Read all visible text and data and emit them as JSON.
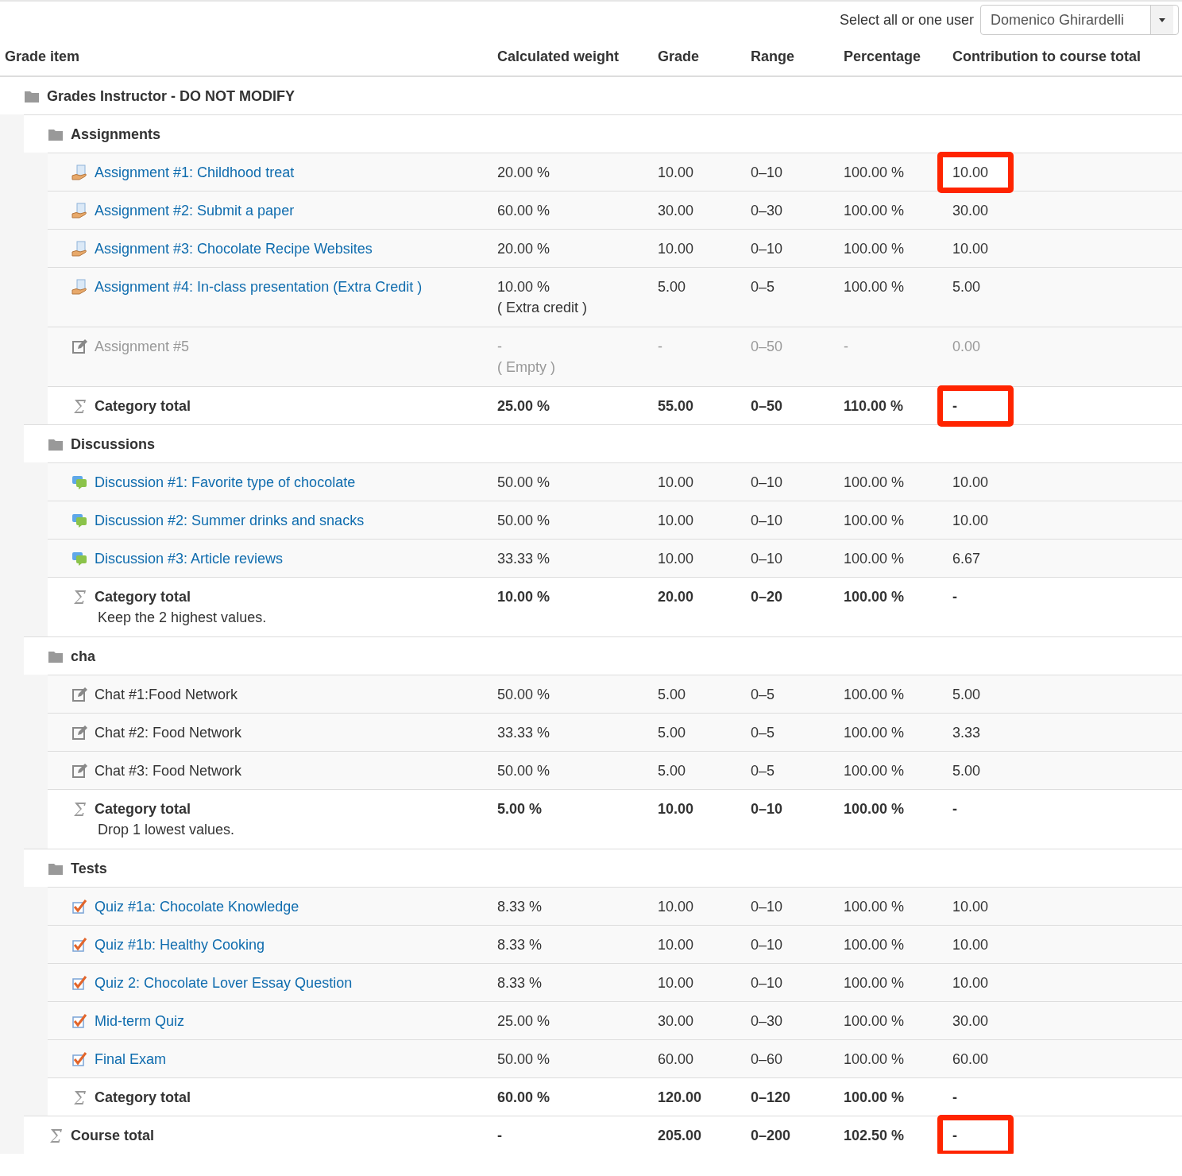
{
  "user_select": {
    "label": "Select all or one user",
    "value": "Domenico Ghirardelli"
  },
  "columns": [
    "Grade item",
    "Calculated weight",
    "Grade",
    "Range",
    "Percentage",
    "Contribution to course total"
  ],
  "report": {
    "kind": "category",
    "name": "Grades Instructor - DO NOT MODIFY",
    "children": [
      {
        "kind": "category",
        "name": "Assignments",
        "children": [
          {
            "kind": "assignment",
            "link": true,
            "dimmed": false,
            "name": "Assignment #1: Childhood treat",
            "weight": "20.00 %",
            "grade": "10.00",
            "range": "0–10",
            "percentage": "100.00 %",
            "contribution": "10.00",
            "highlighted": true
          },
          {
            "kind": "assignment",
            "link": true,
            "dimmed": false,
            "name": "Assignment #2: Submit a paper",
            "weight": "60.00 %",
            "grade": "30.00",
            "range": "0–30",
            "percentage": "100.00 %",
            "contribution": "30.00",
            "highlighted": false
          },
          {
            "kind": "assignment",
            "link": true,
            "dimmed": false,
            "name": "Assignment #3: Chocolate Recipe Websites",
            "weight": "20.00 %",
            "grade": "10.00",
            "range": "0–10",
            "percentage": "100.00 %",
            "contribution": "10.00",
            "highlighted": false
          },
          {
            "kind": "assignment",
            "link": true,
            "dimmed": false,
            "name": "Assignment #4: In-class presentation (Extra Credit )",
            "weight": "10.00 %",
            "weight_note": "( Extra credit )",
            "grade": "5.00",
            "range": "0–5",
            "percentage": "100.00 %",
            "contribution": "5.00",
            "highlighted": false
          },
          {
            "kind": "manual",
            "link": false,
            "dimmed": true,
            "name": "Assignment #5",
            "weight": "-",
            "weight_note": "( Empty )",
            "grade": "-",
            "range": "0–50",
            "percentage": "-",
            "contribution": "0.00",
            "highlighted": false
          },
          {
            "kind": "total",
            "name": "Category total",
            "weight": "25.00 %",
            "grade": "55.00",
            "range": "0–50",
            "percentage": "110.00 %",
            "contribution": "-",
            "highlighted": true
          }
        ]
      },
      {
        "kind": "category",
        "name": "Discussions",
        "children": [
          {
            "kind": "forum",
            "link": true,
            "dimmed": false,
            "name": "Discussion #1: Favorite type of chocolate",
            "weight": "50.00 %",
            "grade": "10.00",
            "range": "0–10",
            "percentage": "100.00 %",
            "contribution": "10.00",
            "highlighted": false
          },
          {
            "kind": "forum",
            "link": true,
            "dimmed": false,
            "name": "Discussion #2: Summer drinks and snacks",
            "weight": "50.00 %",
            "grade": "10.00",
            "range": "0–10",
            "percentage": "100.00 %",
            "contribution": "10.00",
            "highlighted": false
          },
          {
            "kind": "forum",
            "link": true,
            "dimmed": false,
            "name": "Discussion #3: Article reviews",
            "weight": "33.33 %",
            "grade": "10.00",
            "range": "0–10",
            "percentage": "100.00 %",
            "contribution": "6.67",
            "highlighted": false
          },
          {
            "kind": "total",
            "name": "Category total",
            "note": "Keep the 2 highest values.",
            "weight": "10.00 %",
            "grade": "20.00",
            "range": "0–20",
            "percentage": "100.00 %",
            "contribution": "-",
            "highlighted": false
          }
        ]
      },
      {
        "kind": "category",
        "name": "cha",
        "children": [
          {
            "kind": "manual",
            "link": false,
            "dimmed": false,
            "name": "Chat #1:Food Network",
            "weight": "50.00 %",
            "grade": "5.00",
            "range": "0–5",
            "percentage": "100.00 %",
            "contribution": "5.00",
            "highlighted": false
          },
          {
            "kind": "manual",
            "link": false,
            "dimmed": false,
            "name": "Chat #2: Food Network",
            "weight": "33.33 %",
            "grade": "5.00",
            "range": "0–5",
            "percentage": "100.00 %",
            "contribution": "3.33",
            "highlighted": false
          },
          {
            "kind": "manual",
            "link": false,
            "dimmed": false,
            "name": "Chat #3: Food Network",
            "weight": "50.00 %",
            "grade": "5.00",
            "range": "0–5",
            "percentage": "100.00 %",
            "contribution": "5.00",
            "highlighted": false
          },
          {
            "kind": "total",
            "name": "Category total",
            "note": "Drop 1 lowest values.",
            "weight": "5.00 %",
            "grade": "10.00",
            "range": "0–10",
            "percentage": "100.00 %",
            "contribution": "-",
            "highlighted": false
          }
        ]
      },
      {
        "kind": "category",
        "name": "Tests",
        "children": [
          {
            "kind": "quiz",
            "link": true,
            "dimmed": false,
            "name": "Quiz #1a: Chocolate Knowledge",
            "weight": "8.33 %",
            "grade": "10.00",
            "range": "0–10",
            "percentage": "100.00 %",
            "contribution": "10.00",
            "highlighted": false
          },
          {
            "kind": "quiz",
            "link": true,
            "dimmed": false,
            "name": "Quiz #1b: Healthy Cooking",
            "weight": "8.33 %",
            "grade": "10.00",
            "range": "0–10",
            "percentage": "100.00 %",
            "contribution": "10.00",
            "highlighted": false
          },
          {
            "kind": "quiz",
            "link": true,
            "dimmed": false,
            "name": "Quiz 2: Chocolate Lover Essay Question",
            "weight": "8.33 %",
            "grade": "10.00",
            "range": "0–10",
            "percentage": "100.00 %",
            "contribution": "10.00",
            "highlighted": false
          },
          {
            "kind": "quiz",
            "link": true,
            "dimmed": false,
            "name": "Mid-term Quiz",
            "weight": "25.00 %",
            "grade": "30.00",
            "range": "0–30",
            "percentage": "100.00 %",
            "contribution": "30.00",
            "highlighted": false
          },
          {
            "kind": "quiz",
            "link": true,
            "dimmed": false,
            "name": "Final Exam",
            "weight": "50.00 %",
            "grade": "60.00",
            "range": "0–60",
            "percentage": "100.00 %",
            "contribution": "60.00",
            "highlighted": false
          },
          {
            "kind": "total",
            "name": "Category total",
            "weight": "60.00 %",
            "grade": "120.00",
            "range": "0–120",
            "percentage": "100.00 %",
            "contribution": "-",
            "highlighted": false
          }
        ]
      },
      {
        "kind": "total",
        "name": "Course total",
        "weight": "-",
        "grade": "205.00",
        "range": "0–200",
        "percentage": "102.50 %",
        "contribution": "-",
        "highlighted": true
      }
    ]
  }
}
